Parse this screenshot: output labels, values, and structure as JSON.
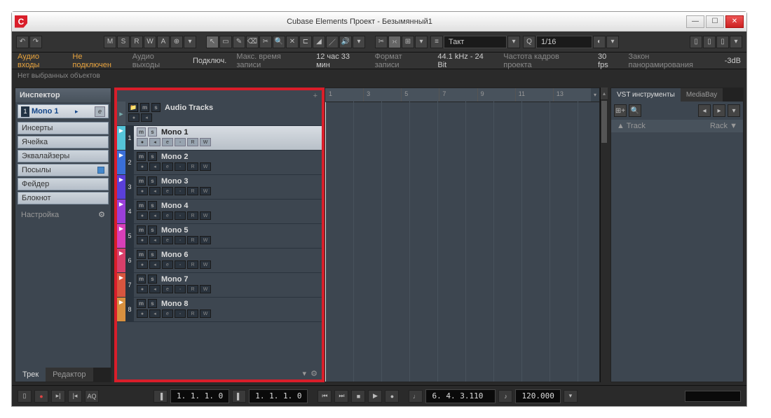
{
  "window": {
    "title": "Cubase Elements Проект - Безымянный1"
  },
  "toolbar": {
    "auto_letters": [
      "M",
      "S",
      "R",
      "W",
      "A"
    ],
    "grid_label": "Такт",
    "quantize_label": "Q",
    "quantize_value": "1/16"
  },
  "status": {
    "audio_in_lbl": "Аудио входы",
    "audio_in_val": "Не подключен",
    "audio_out_lbl": "Аудио выходы",
    "audio_out_val": "Подключ.",
    "rec_time_lbl": "Макс. время записи",
    "rec_time_val": "12 час 33 мин",
    "rec_fmt_lbl": "Формат записи",
    "rec_fmt_val": "44.1 kHz - 24 Bit",
    "fps_lbl": "Частота кадров проекта",
    "fps_val": "30 fps",
    "pan_lbl": "Закон панорамирования",
    "pan_val": "-3dB"
  },
  "info": {
    "msg": "Нет выбранных объектов"
  },
  "inspector": {
    "title": "Инспектор",
    "track_num": "1",
    "track_name": "Mono 1",
    "items": [
      {
        "label": "Инсерты"
      },
      {
        "label": "Ячейка"
      },
      {
        "label": "Эквалайзеры"
      },
      {
        "label": "Посылы",
        "indic": true
      },
      {
        "label": "Фейдер"
      },
      {
        "label": "Блокнот"
      }
    ],
    "settings": "Настройка",
    "tabs": [
      "Трек",
      "Редактор"
    ]
  },
  "tracks": {
    "folder": "Audio Tracks",
    "list": [
      {
        "n": "1",
        "name": "Mono 1",
        "color": "#55c4d8",
        "sel": true
      },
      {
        "n": "2",
        "name": "Mono 2",
        "color": "#3a6fd8"
      },
      {
        "n": "3",
        "name": "Mono 3",
        "color": "#5a3fd8"
      },
      {
        "n": "4",
        "name": "Mono 4",
        "color": "#9a3fd8"
      },
      {
        "n": "5",
        "name": "Mono 5",
        "color": "#d83fb8"
      },
      {
        "n": "6",
        "name": "Mono 6",
        "color": "#d83f6a"
      },
      {
        "n": "7",
        "name": "Mono 7",
        "color": "#d8553f"
      },
      {
        "n": "8",
        "name": "Mono 8",
        "color": "#d8903f"
      }
    ]
  },
  "ruler": [
    "1",
    "3",
    "5",
    "7",
    "9",
    "11",
    "13"
  ],
  "vst": {
    "tabs": [
      "VST инструменты",
      "MediaBay"
    ],
    "hdr_track": "▲ Track",
    "hdr_rack": "Rack ▼"
  },
  "transport": {
    "left_pos": "1. 1. 1.  0",
    "right_pos": "1. 1. 1.  0",
    "cursor_pos": "6.  4.  3.110",
    "tempo": "120.000",
    "aq": "AQ"
  }
}
